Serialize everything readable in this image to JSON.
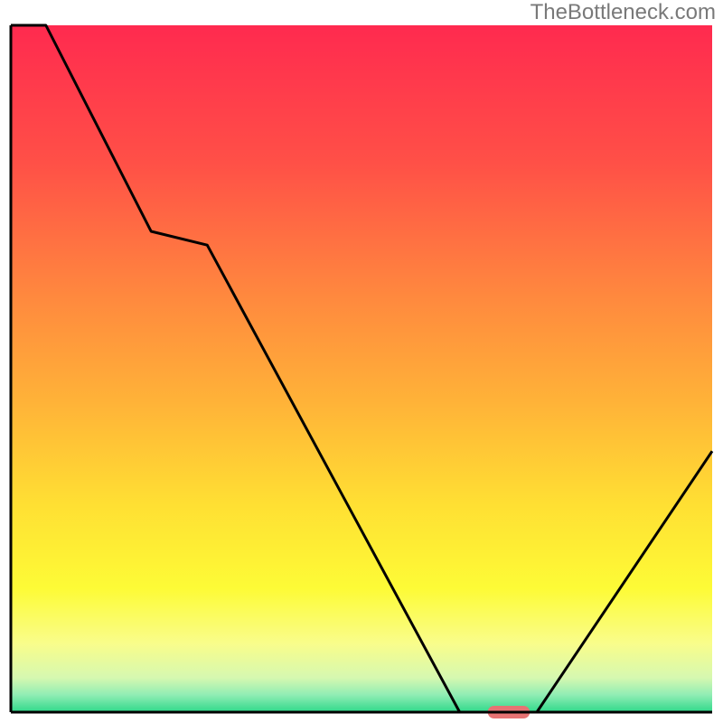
{
  "watermark": "TheBottleneck.com",
  "chart_data": {
    "type": "line",
    "title": "",
    "xlabel": "",
    "ylabel": "",
    "xlim": [
      0,
      100
    ],
    "ylim": [
      0,
      100
    ],
    "x": [
      0,
      5,
      20,
      28,
      64,
      70,
      75,
      100
    ],
    "values": [
      100,
      100,
      70,
      68,
      0,
      0,
      0,
      38
    ],
    "gradient_stops": [
      {
        "offset": 0.0,
        "color": "#ff2a4f"
      },
      {
        "offset": 0.2,
        "color": "#ff5047"
      },
      {
        "offset": 0.4,
        "color": "#ff8a3e"
      },
      {
        "offset": 0.55,
        "color": "#ffb338"
      },
      {
        "offset": 0.7,
        "color": "#ffe033"
      },
      {
        "offset": 0.82,
        "color": "#fdfb36"
      },
      {
        "offset": 0.9,
        "color": "#f9fd8b"
      },
      {
        "offset": 0.95,
        "color": "#d6f8b0"
      },
      {
        "offset": 0.975,
        "color": "#90edb4"
      },
      {
        "offset": 1.0,
        "color": "#2fd88a"
      }
    ],
    "marker": {
      "x": 71,
      "y": 0,
      "width": 6,
      "color": "#e77373"
    }
  }
}
